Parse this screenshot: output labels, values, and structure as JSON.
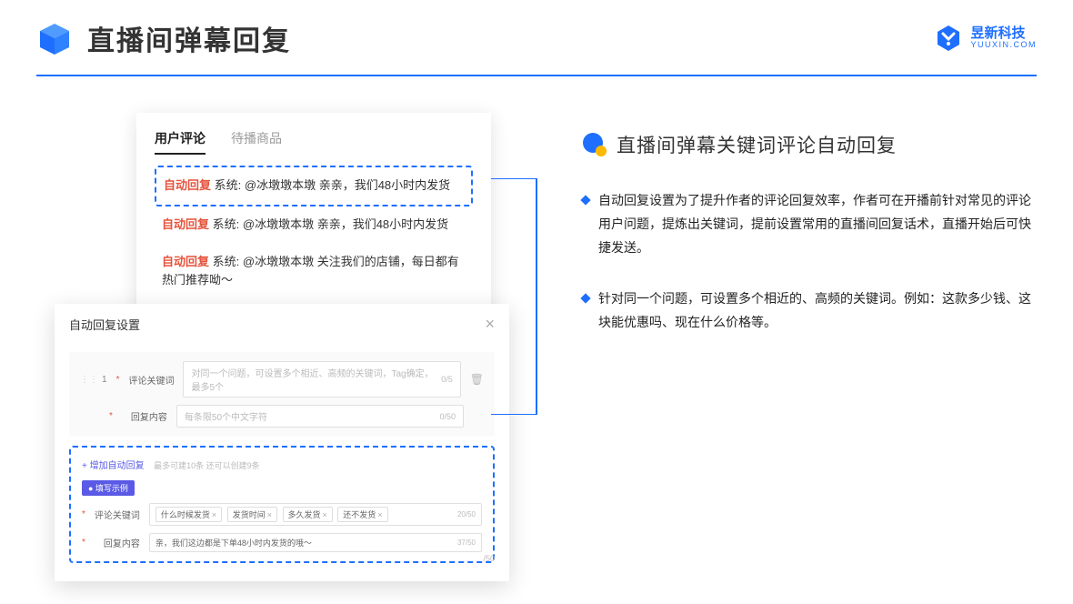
{
  "header": {
    "title": "直播间弹幕回复",
    "brand_name": "昱新科技",
    "brand_url": "YUUXIN.COM"
  },
  "card1": {
    "tab_active": "用户评论",
    "tab_other": "待播商品",
    "c1_label": "自动回复",
    "c1_sys": "系统:",
    "c1_text": "@冰墩墩本墩 亲亲，我们48小时内发货",
    "c2_label": "自动回复",
    "c2_sys": "系统:",
    "c2_text": "@冰墩墩本墩 亲亲，我们48小时内发货",
    "c3_label": "自动回复",
    "c3_sys": "系统:",
    "c3_text": "@冰墩墩本墩 关注我们的店铺，每日都有热门推荐呦～"
  },
  "card2": {
    "title": "自动回复设置",
    "row_num": "1",
    "kw_label": "评论关键词",
    "kw_placeholder": "对同一个问题，可设置多个相近、高频的关键词，Tag确定，最多5个",
    "kw_count": "0/5",
    "rc_label": "回复内容",
    "rc_placeholder": "每条限50个中文字符",
    "rc_count": "0/50",
    "add_link": "+ 增加自动回复",
    "add_hint": "最多可建10条 还可以创建9条",
    "badge": "● 填写示例",
    "ex_kw_label": "评论关键词",
    "ex_tag1": "什么时候发货",
    "ex_tag2": "发货时间",
    "ex_tag3": "多久发货",
    "ex_tag4": "还不发货",
    "ex_kw_count": "20/50",
    "ex_rc_label": "回复内容",
    "ex_rc_text": "亲，我们这边都是下单48小时内发货的哦～",
    "ex_rc_count": "37/50",
    "trail": "/50"
  },
  "right": {
    "title": "直播间弹幕关键词评论自动回复",
    "b1": "自动回复设置为了提升作者的评论回复效率，作者可在开播前针对常见的评论用户问题，提炼出关键词，提前设置常用的直播间回复话术，直播开始后可快捷发送。",
    "b2": "针对同一个问题，可设置多个相近的、高频的关键词。例如：这款多少钱、这块能优惠吗、现在什么价格等。"
  }
}
